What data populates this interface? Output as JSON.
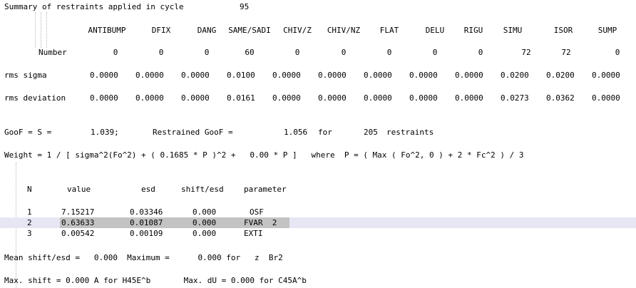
{
  "summary": {
    "title": "Summary of restraints applied in cycle",
    "cycle": "95"
  },
  "restraints": {
    "columns": [
      "ANTIBUMP",
      "DFIX",
      "DANG",
      "SAME/SADI",
      "CHIV/Z",
      "CHIV/NZ",
      "FLAT",
      "DELU",
      "RIGU",
      "SIMU",
      "ISOR",
      "SUMP"
    ],
    "number_label": "Number",
    "numbers": [
      "0",
      "0",
      "0",
      "60",
      "0",
      "0",
      "0",
      "0",
      "0",
      "72",
      "72",
      "0"
    ],
    "rms_sigma_label": "rms sigma",
    "rms_sigma": [
      "0.0000",
      "0.0000",
      "0.0000",
      "0.0100",
      "0.0000",
      "0.0000",
      "0.0000",
      "0.0000",
      "0.0000",
      "0.0200",
      "0.0200",
      "0.0000"
    ],
    "rms_deviation_label": "rms deviation",
    "rms_deviation": [
      "0.0000",
      "0.0000",
      "0.0000",
      "0.0161",
      "0.0000",
      "0.0000",
      "0.0000",
      "0.0000",
      "0.0000",
      "0.0273",
      "0.0362",
      "0.0000"
    ]
  },
  "goof": {
    "label": "GooF = S =",
    "value": "1.039;",
    "restrained_label": "Restrained GooF =",
    "restrained_value": "1.056",
    "for_word": "for",
    "restraint_count": "205",
    "restraints_word": "restraints"
  },
  "weight_line": "Weight = 1 / [ sigma^2(Fo^2) + ( 0.1685 * P )^2 +   0.00 * P ]   where  P = ( Max ( Fo^2, 0 ) + 2 * Fc^2 ) / 3",
  "params": {
    "headers": {
      "n": "N",
      "value": "value",
      "esd": "esd",
      "shift": "shift/esd",
      "parameter": "parameter"
    },
    "rows": [
      {
        "n": "1",
        "value": "7.15217",
        "esd": "0.03346",
        "shift": "0.000",
        "parameter": "OSF"
      },
      {
        "n": "2",
        "value": "0.63633",
        "esd": "0.01087",
        "shift": "0.000",
        "parameter": "FVAR  2"
      },
      {
        "n": "3",
        "value": "0.00542",
        "esd": "0.00109",
        "shift": "0.000",
        "parameter": "EXTI"
      }
    ]
  },
  "mean_shift_line": "Mean shift/esd =   0.000  Maximum =      0.000 for   z  Br2",
  "max_shift_line": "Max. shift = 0.000 A for H45E^b       Max. dU = 0.000 for C45A^b"
}
